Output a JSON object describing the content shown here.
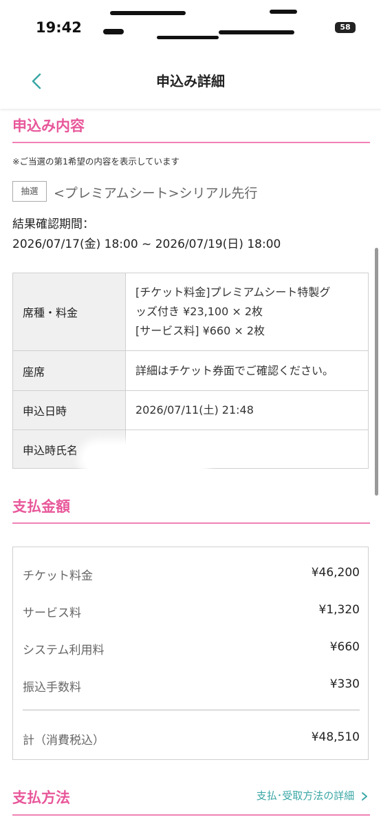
{
  "status_bar": {
    "time": "19:42",
    "battery": "58"
  },
  "nav": {
    "title": "申込み詳細"
  },
  "application": {
    "section_title": "申込み内容",
    "note": "※ご当選の第1希望の内容を表示しています",
    "badge": "抽選",
    "plan_name": "<プレミアムシート>シリアル先行",
    "result_period_label": "結果確認期間：",
    "result_period": "2026/07/17(金) 18:00 ~ 2026/07/19(日) 18:00",
    "table": [
      {
        "label": "席種・料金",
        "lines": [
          "[チケット料金]プレミアムシート特製グ",
          "ッズ付き ¥23,100 × 2枚",
          "[サービス料] ¥660 × 2枚"
        ]
      },
      {
        "label": "座席",
        "lines": [
          "詳細はチケット券面でご確認ください。"
        ]
      },
      {
        "label": "申込日時",
        "lines": [
          "2026/07/11(土) 21:48"
        ]
      },
      {
        "label": "申込時氏名",
        "lines": [
          ""
        ]
      }
    ]
  },
  "payment": {
    "section_title": "支払金額",
    "rows": [
      {
        "label": "チケット料金",
        "value": "¥46,200"
      },
      {
        "label": "サービス料",
        "value": "¥1,320"
      },
      {
        "label": "システム利用料",
        "value": "¥660"
      },
      {
        "label": "振込手数料",
        "value": "¥330"
      }
    ],
    "total_label": "計（消費税込）",
    "total_value": "¥48,510"
  },
  "method": {
    "section_title": "支払方法",
    "link_label": "支払･受取方法の詳細",
    "link_icon": "chevron-right-icon"
  },
  "colors": {
    "accent_pink": "#e8579a",
    "link_teal": "#3aa7a5"
  }
}
